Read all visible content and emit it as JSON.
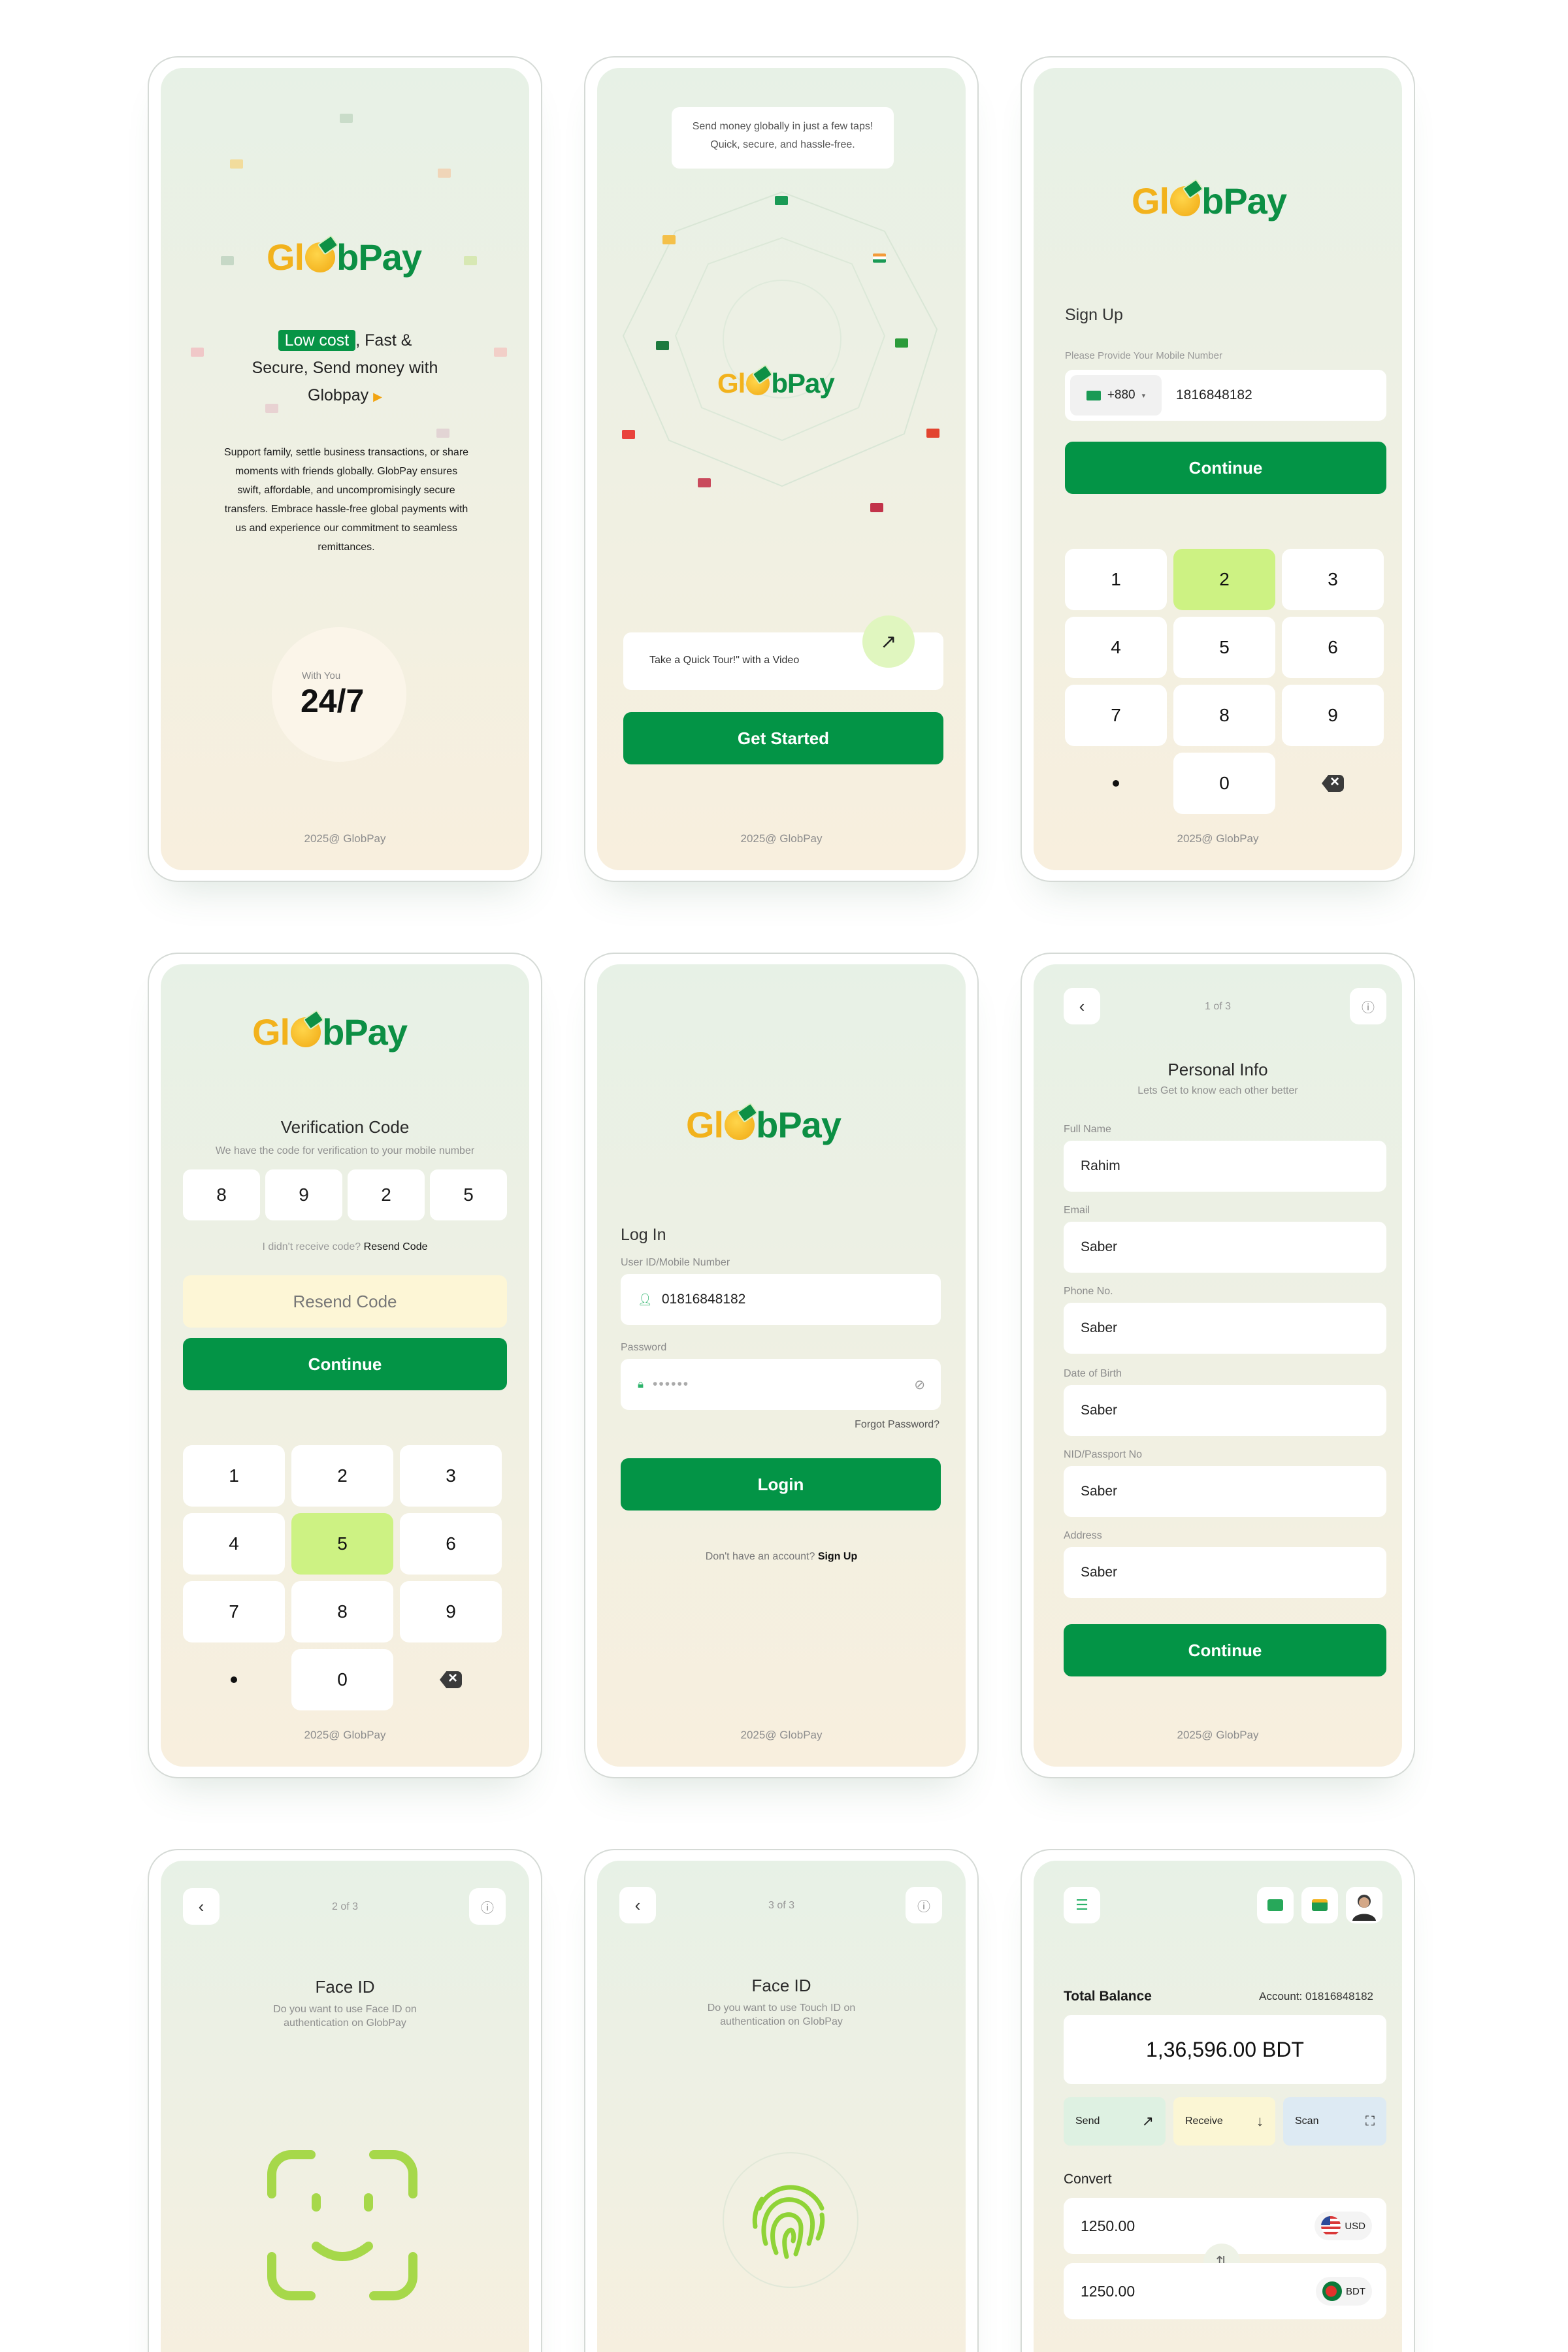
{
  "brand": {
    "logo_left": "Gl",
    "logo_right": "bPay"
  },
  "footer": "2025@ GlobPay",
  "screen1": {
    "badge": "Low cost",
    "headline_1": ", Fast &",
    "headline_2": "Secure, Send money with",
    "headline_3": "Globpay",
    "description": "Support family, settle business transactions, or share moments with friends globally. GlobPay ensures swift, affordable, and uncompromisingly secure transfers. Embrace hassle-free global payments with us and experience our commitment to seamless remittances.",
    "with_you": "With You",
    "hours": "24/7"
  },
  "screen2": {
    "tooltip": "Send money globally in just a few taps! Quick, secure, and hassle-free.",
    "tour_label": "Take a Quick Tour!\" with a Video",
    "get_started": "Get Started"
  },
  "screen3": {
    "heading": "Sign Up",
    "hint": "Please Provide Your Mobile Number",
    "country_code": "+880",
    "phone": "1816848182",
    "continue": "Continue",
    "keys": [
      "1",
      "2",
      "3",
      "4",
      "5",
      "6",
      "7",
      "8",
      "9",
      "0"
    ]
  },
  "screen4": {
    "heading": "Verification Code",
    "hint": "We have the code for verification to your mobile number",
    "digits": [
      "8",
      "9",
      "2",
      "5"
    ],
    "didnt_receive": "I didn't receive code?",
    "resend_link": "Resend Code",
    "resend_button": "Resend Code",
    "continue": "Continue",
    "keys": [
      "1",
      "2",
      "3",
      "4",
      "5",
      "6",
      "7",
      "8",
      "9",
      "0"
    ]
  },
  "screen5": {
    "heading": "Log In",
    "user_label": "User ID/Mobile Number",
    "user_value": "01816848182",
    "password_label": "Password",
    "password_value": "••••••",
    "forgot": "Forgot Password?",
    "login": "Login",
    "no_account": "Don't have an account?",
    "signup": "Sign Up"
  },
  "screen6": {
    "step": "1 of 3",
    "heading": "Personal Info",
    "sub": "Lets Get to know each other better",
    "fields": [
      {
        "label": "Full Name",
        "value": "Rahim"
      },
      {
        "label": "Email",
        "value": "Saber"
      },
      {
        "label": "Phone No.",
        "value": "Saber"
      },
      {
        "label": "Date of Birth",
        "value": "Saber"
      },
      {
        "label": "NID/Passport No",
        "value": "Saber"
      },
      {
        "label": "Address",
        "value": "Saber"
      }
    ],
    "continue": "Continue"
  },
  "screen7": {
    "step": "2 of 3",
    "heading": "Face ID",
    "sub": "Do you want to use Face ID on authentication on GlobPay"
  },
  "screen8": {
    "step": "3 of 3",
    "heading": "Face ID",
    "sub": "Do you want to use Touch ID on authentication on GlobPay"
  },
  "screen9": {
    "total_balance": "Total Balance",
    "account": "Account: 01816848182",
    "balance": "1,36,596.00 BDT",
    "send": "Send",
    "receive": "Receive",
    "scan": "Scan",
    "convert": "Convert",
    "from_amount": "1250.00",
    "from_currency": "USD",
    "to_amount": "1250.00",
    "to_currency": "BDT"
  },
  "colors": {
    "primary": "#039446",
    "accent": "#cdf283",
    "gold": "#f2b21c"
  }
}
